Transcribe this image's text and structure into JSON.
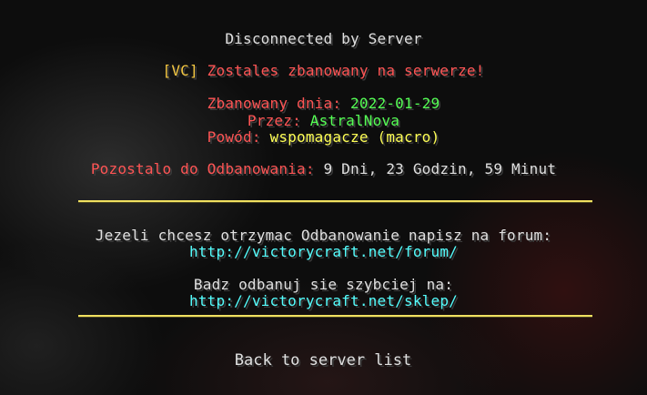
{
  "screen": {
    "title": "Disconnected by Server"
  },
  "ban_message": {
    "prefix": "[VC]",
    "headline": "Zostales zbanowany na serwerze!",
    "date_label": "Zbanowany dnia:",
    "date_value": "2022-01-29",
    "by_label": "Przez:",
    "by_value": "AstralNova",
    "reason_label": "Powód:",
    "reason_value": "wspomagacze (macro)",
    "remaining_label": "Pozostalo do Odbanowania:",
    "remaining_value": "9 Dni, 23 Godzin, 59 Minut"
  },
  "info": {
    "forum_text": "Jezeli chcesz otrzymac Odbanowanie napisz na forum:",
    "forum_link": "http://victorycraft.net/forum/",
    "shop_text": "Badz odbanuj sie szybciej na:",
    "shop_link": "http://victorycraft.net/sklep/"
  },
  "buttons": {
    "back_label": "Back to server list"
  },
  "colors": {
    "gray": "#e0e0e0",
    "gold": "#f5c842",
    "red": "#ff5555",
    "green": "#55ff55",
    "yellow": "#ffff55",
    "aqua": "#55ffff",
    "divider": "#f0e060"
  }
}
